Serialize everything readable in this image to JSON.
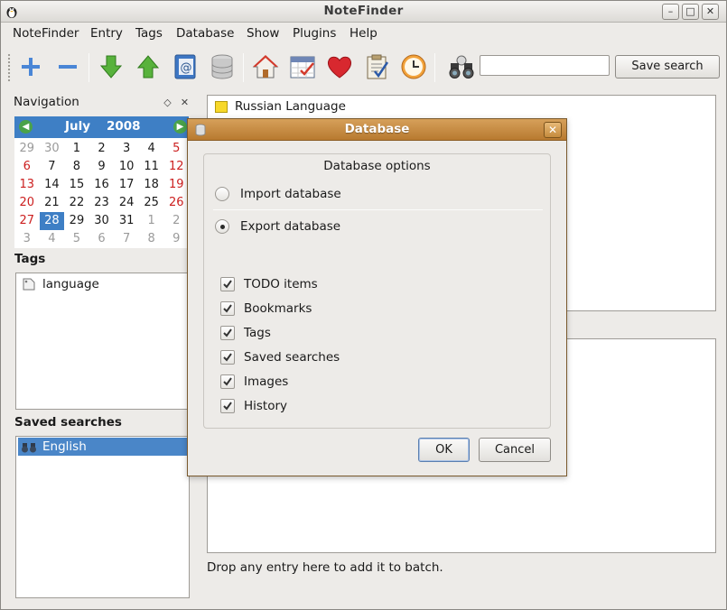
{
  "window": {
    "title": "NoteFinder"
  },
  "titlebar_buttons": [
    "–",
    "□",
    "✕"
  ],
  "menu": [
    {
      "label": "NoteFinder"
    },
    {
      "label": "Entry"
    },
    {
      "label": "Tags"
    },
    {
      "label": "Database"
    },
    {
      "label": "Show"
    },
    {
      "label": "Plugins"
    },
    {
      "label": "Help"
    }
  ],
  "toolbar": {
    "icons": [
      "add-icon",
      "remove-icon",
      "download-icon",
      "upload-icon",
      "address-book-icon",
      "database-icon",
      "home-icon",
      "calendar-icon",
      "heart-icon",
      "clipboard-todo-icon",
      "clock-icon",
      "binoculars-icon"
    ],
    "search_value": "",
    "save_search_label": "Save search"
  },
  "navigation": {
    "title": "Navigation",
    "calendar": {
      "month": "July",
      "year": "2008",
      "weeks": [
        [
          "29",
          "30",
          "1",
          "2",
          "3",
          "4",
          "5"
        ],
        [
          "6",
          "7",
          "8",
          "9",
          "10",
          "11",
          "12"
        ],
        [
          "13",
          "14",
          "15",
          "16",
          "17",
          "18",
          "19"
        ],
        [
          "20",
          "21",
          "22",
          "23",
          "24",
          "25",
          "26"
        ],
        [
          "27",
          "28",
          "29",
          "30",
          "31",
          "1",
          "2"
        ],
        [
          "3",
          "4",
          "5",
          "6",
          "7",
          "8",
          "9"
        ]
      ],
      "selected": "28"
    }
  },
  "tags": {
    "title": "Tags",
    "items": [
      {
        "label": "language"
      }
    ]
  },
  "saved_searches": {
    "title": "Saved searches",
    "items": [
      {
        "label": "English"
      }
    ]
  },
  "notes": {
    "items": [
      {
        "label": "Russian Language"
      }
    ]
  },
  "batch": {
    "hint": "Drop any entry here to add it to batch."
  },
  "dialog": {
    "title": "Database",
    "group_title": "Database options",
    "options": [
      {
        "label": "Import database",
        "selected": false
      },
      {
        "label": "Export database",
        "selected": true
      }
    ],
    "checkboxes": [
      {
        "label": "TODO items",
        "checked": true
      },
      {
        "label": "Bookmarks",
        "checked": true
      },
      {
        "label": "Tags",
        "checked": true
      },
      {
        "label": "Saved searches",
        "checked": true
      },
      {
        "label": "Images",
        "checked": true
      },
      {
        "label": "History",
        "checked": true
      }
    ],
    "ok_label": "OK",
    "cancel_label": "Cancel"
  },
  "colors": {
    "accent": "#3e7fc5",
    "dialog_title": "#c68a3e",
    "weekend": "#cc1f1f"
  }
}
